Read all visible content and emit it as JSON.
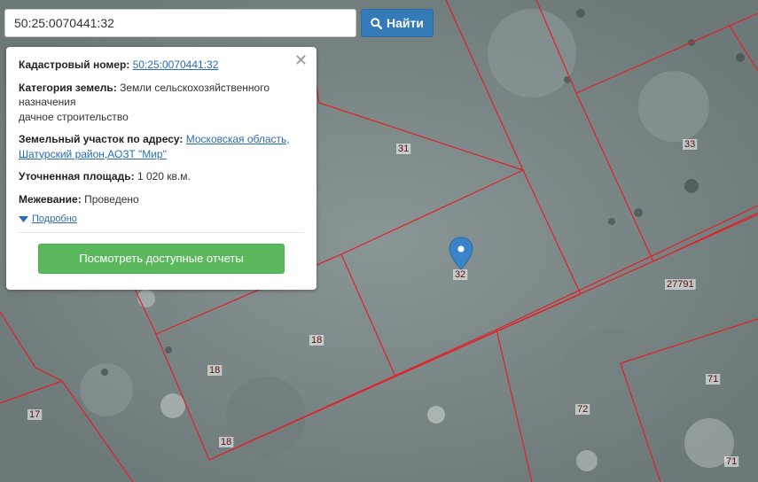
{
  "search": {
    "value": "50:25:0070441:32",
    "button_label": "Найти",
    "button_icon": "search-icon"
  },
  "popup": {
    "cadastral": {
      "label": "Кадастровый номер:",
      "value": "50:25:0070441:32"
    },
    "category": {
      "label": "Категория земель:",
      "value": "Земли сельскохозяйственного назначения",
      "use": "дачное строительство"
    },
    "address": {
      "label": "Земельный участок по адресу:",
      "value": "Московская область, Шатурский район,АОЗТ \"Мир\""
    },
    "area": {
      "label": "Уточненная площадь:",
      "value": "1 020 кв.м."
    },
    "survey": {
      "label": "Межевание:",
      "value": "Проведено"
    },
    "details_label": "Подробно",
    "reports_button": "Посмотреть доступные отчеты"
  },
  "map": {
    "parcel_labels": [
      "31",
      "33",
      "32",
      "27791",
      "18",
      "18",
      "18",
      "17",
      "71",
      "71",
      "72"
    ],
    "line_color": "#e0202a"
  }
}
